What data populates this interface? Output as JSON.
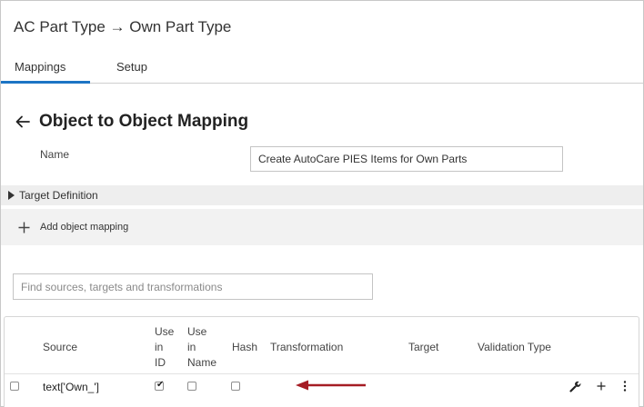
{
  "app": {
    "title": "AC Part Type → Own Part Type"
  },
  "tabs": [
    {
      "label": "Mappings",
      "active": true
    },
    {
      "label": "Setup",
      "active": false
    }
  ],
  "page": {
    "title": "Object to Object Mapping",
    "name_label": "Name",
    "name_value": "Create AutoCare PIES Items for Own Parts"
  },
  "target_definition": {
    "label": "Target Definition",
    "expanded": false
  },
  "add_mapping": {
    "label": "Add object mapping"
  },
  "search": {
    "placeholder": "Find sources, targets and transformations"
  },
  "table": {
    "headers": {
      "source": "Source",
      "use_in_id_1": "Use",
      "use_in_id_2": "in",
      "use_in_id_3": "ID",
      "use_in_name_1": "Use",
      "use_in_name_2": "in",
      "use_in_name_3": "Name",
      "hash": "Hash",
      "transformation": "Transformation",
      "target": "Target",
      "validation_type": "Validation Type"
    },
    "rows": [
      {
        "selected": false,
        "source": "text['Own_']",
        "use_in_id": true,
        "use_in_name": false,
        "hash": false,
        "transformation": "",
        "target": "",
        "validation_type": ""
      }
    ]
  },
  "annotation": {
    "arrow_color": "#a51c24"
  },
  "colors": {
    "accent": "#1c74c4",
    "section_bg": "#eeeeee"
  },
  "icons": [
    "back-arrow-icon",
    "triangle-right-icon",
    "plus-icon",
    "wrench-icon",
    "plus-icon",
    "more-vertical-icon"
  ]
}
